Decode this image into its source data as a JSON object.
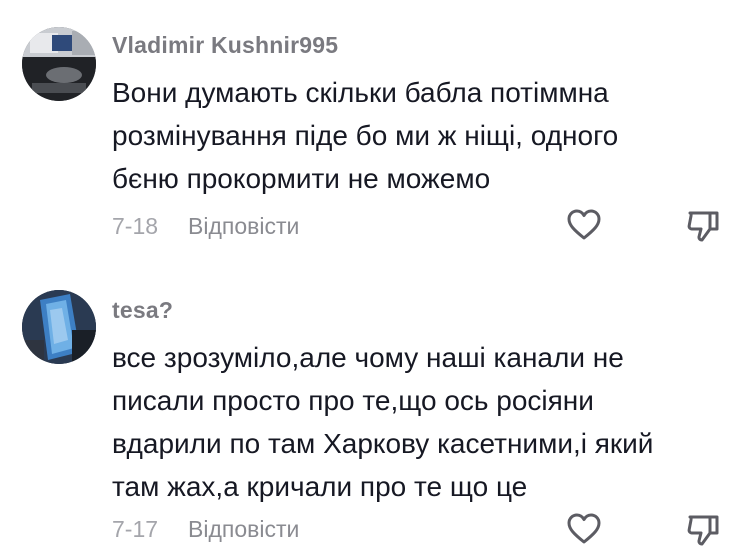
{
  "comments": [
    {
      "username": "Vladimir Kushnir995",
      "lines": [
        "Вони думають скільки бабла потіммна",
        "розмінування піде бо ми ж ніщі, одного",
        "бєню прокормити не можемо"
      ],
      "date": "7-18",
      "reply_label": "Відповісти",
      "like_icon": "heart-outline-icon",
      "dislike_icon": "thumbs-down-outline-icon"
    },
    {
      "username": "tesa?",
      "lines": [
        "все зрозуміло,але чому наші канали не",
        "писали просто про те,що ось росіяни",
        "вдарили по там Харкову касетними,і який",
        "там жах,а кричали про те що це"
      ],
      "date": "7-17",
      "reply_label": "Відповісти",
      "like_icon": "heart-outline-icon",
      "dislike_icon": "thumbs-down-outline-icon"
    }
  ],
  "colors": {
    "text": "#161823",
    "username": "#7a7a80",
    "meta": "#8a8b91",
    "icon": "#5c5c63"
  }
}
